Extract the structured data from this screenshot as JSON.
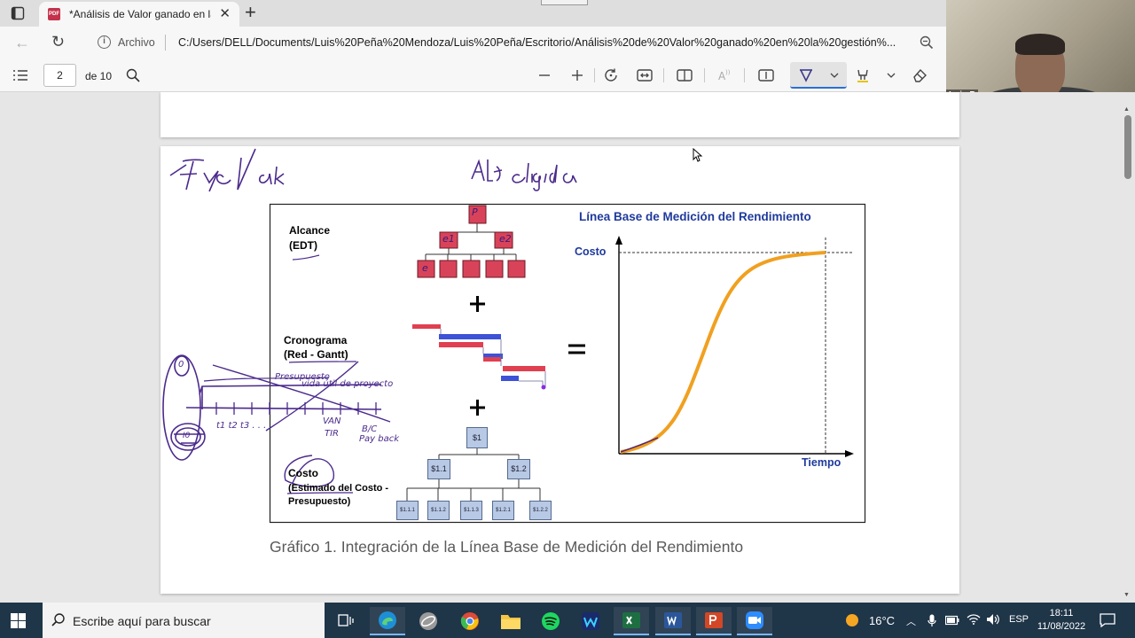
{
  "browser": {
    "tab_title": "*Análisis de Valor ganado en la g",
    "address_prefix": "Archivo",
    "url": "C:/Users/DELL/Documents/Luis%20Peña%20Mendoza/Luis%20Peña/Escritorio/Análisis%20de%20Valor%20ganado%20en%20la%20gestión%..."
  },
  "pdf_toolbar": {
    "page_current": "2",
    "page_total_label": "de 10"
  },
  "webcam": {
    "participant_name": "Luis P"
  },
  "figure": {
    "title": "Línea Base de Medición del Rendimiento",
    "scope_label_1": "Alcance",
    "scope_label_2": "(EDT)",
    "schedule_label_1": "Cronograma",
    "schedule_label_2": "(Red - Gantt)",
    "cost_label_1": "Costo",
    "cost_label_2": "(Estimado del Costo -",
    "cost_label_3": "Presupuesto)",
    "y_axis_label": "Costo",
    "x_axis_label": "Tiempo",
    "equals": "=",
    "plus": "+",
    "cost_nodes": {
      "root": "$1",
      "level2": [
        "$1.1",
        "$1.2"
      ],
      "level3": [
        "$1.1.1",
        "$1.1.2",
        "$1.1.3",
        "$1.2.1",
        "$1.2.2"
      ]
    },
    "wbs_nodes": {
      "root": "P",
      "level2": [
        "e1",
        "e2"
      ],
      "level3_first": "e"
    },
    "caption": "Gráfico 1. Integración de la Línea Base de Medición del Rendimiento"
  },
  "handwriting": {
    "top_left": "FyE Vak",
    "top_center": "Alt. elegida",
    "note_1": "Presupuesto",
    "note_2": "vida útil de proyecto",
    "note_3": "t1 t2 t3 . . .",
    "note_4": "VAN",
    "note_5": "TIR",
    "note_6": "B/C",
    "note_7": "Pay back",
    "note_8": "I0",
    "note_9": "0"
  },
  "taskbar": {
    "search_placeholder": "Escribe aquí para buscar",
    "weather": "16°C",
    "language": "ESP",
    "time": "18:11",
    "date": "11/08/2022"
  },
  "colors": {
    "accent_blue": "#2b6fd4",
    "title_blue": "#1f3a9c",
    "s_curve": "#f0a020",
    "wbs_box": "#d9435a",
    "cost_box": "#b8c9e6",
    "taskbar": "#1f3548",
    "ink": "#4b2a8c"
  }
}
